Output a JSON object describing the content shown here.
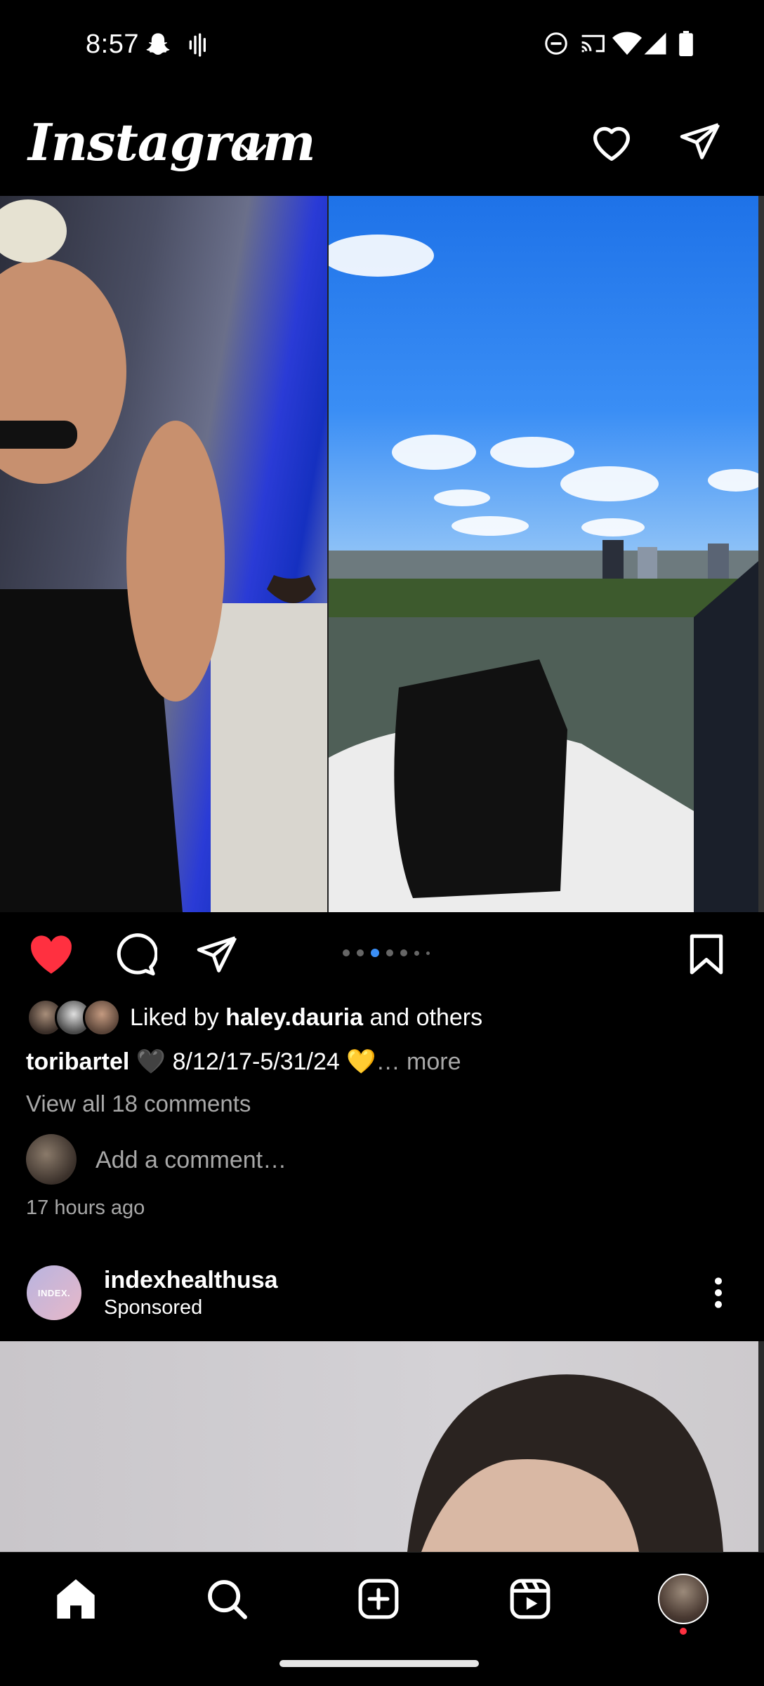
{
  "status_bar": {
    "time": "8:57",
    "left_icons": [
      "snapchat-icon",
      "voice-wave-icon"
    ],
    "right_icons": [
      "do-not-disturb-icon",
      "cast-icon",
      "wifi-icon",
      "signal-icon",
      "battery-icon"
    ]
  },
  "header": {
    "title": "Instagram"
  },
  "post": {
    "carousel": {
      "total": 7,
      "active_index": 2
    },
    "liked_by_prefix": "Liked by ",
    "liked_by_user": "haley.dauria",
    "liked_by_suffix": " and others",
    "caption_user": "toribartel",
    "caption_text": " 🖤 8/12/17-5/31/24 💛",
    "caption_more": "… more",
    "view_comments": "View all 18 comments",
    "comment_placeholder": "Add a comment…",
    "time": "17 hours ago"
  },
  "sponsored_post": {
    "avatar_text": "INDEX.",
    "username": "indexhealthusa",
    "label": "Sponsored"
  },
  "colors": {
    "background": "#000000",
    "like_red": "#ff3040",
    "active_dot": "#3a8ef5",
    "secondary_text": "#a8a8a8"
  }
}
